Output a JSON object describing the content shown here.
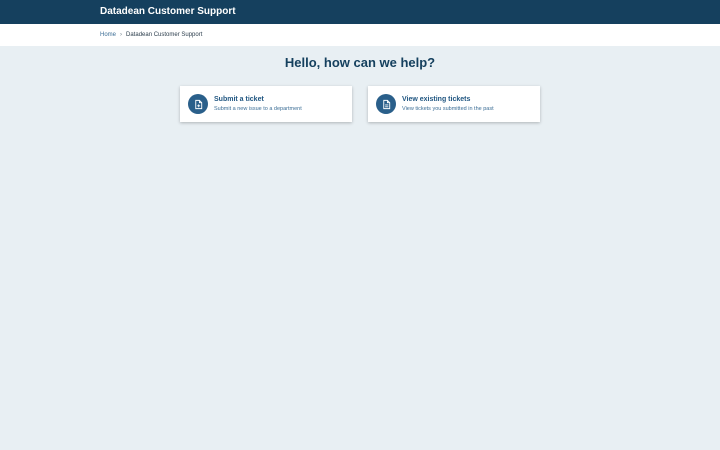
{
  "header": {
    "title": "Datadean Customer Support"
  },
  "breadcrumb": {
    "home": "Home",
    "separator": "›",
    "current": "Datadean Customer Support"
  },
  "main": {
    "heading": "Hello, how can we help?",
    "cards": [
      {
        "title": "Submit a ticket",
        "description": "Submit a new issue to a department",
        "icon": "document-plus-icon"
      },
      {
        "title": "View existing tickets",
        "description": "View tickets you submitted in the past",
        "icon": "document-lines-icon"
      }
    ]
  },
  "colors": {
    "header_bg": "#15405e",
    "page_bg": "#e8eff3",
    "accent": "#2a5f8a"
  }
}
